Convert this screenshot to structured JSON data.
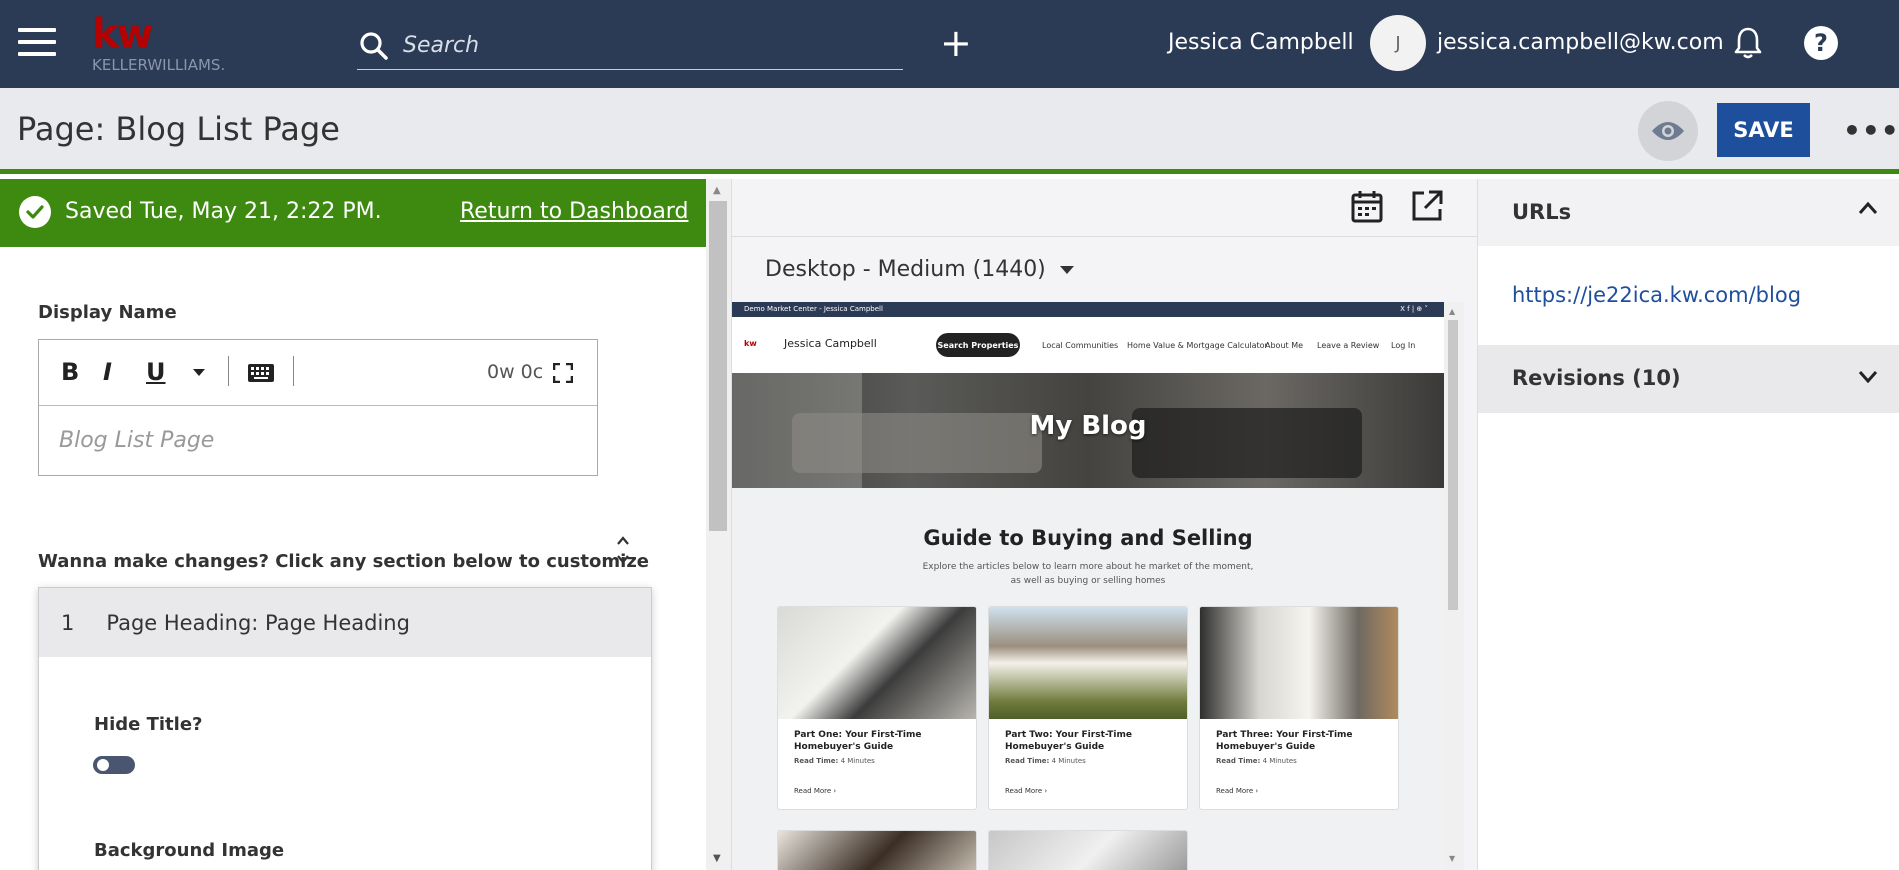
{
  "topbar": {
    "logo_mark": "kw",
    "logo_text": "KELLERWILLIAMS.",
    "search_placeholder": "Search",
    "add_label": "+",
    "user_name": "Jessica Campbell",
    "avatar_initial": "J",
    "user_email": "jessica.campbell@kw.com",
    "help_label": "?",
    "icons": [
      "hamburger-icon",
      "search-icon",
      "plus-icon",
      "bell-icon",
      "help-icon"
    ]
  },
  "pagebar": {
    "title": "Page: Blog List Page",
    "save_label": "SAVE",
    "more_label": "•••"
  },
  "left": {
    "saved_text": "Saved Tue, May 21, 2:22 PM.",
    "return_link": "Return to Dashboard",
    "display_name_label": "Display Name",
    "editor": {
      "bold": "B",
      "italic": "I",
      "underline": "U",
      "counter": "0w 0c",
      "placeholder": "Blog List Page"
    },
    "customize_label": "Wanna make changes? Click any section below to customize",
    "section": {
      "number": "1",
      "name": "Page Heading: Page Heading",
      "hide_title_label": "Hide Title?",
      "hide_title_on": false,
      "background_label": "Background Image"
    }
  },
  "middle": {
    "viewport": "Desktop - Medium (1440)",
    "preview": {
      "strip_left": "Demo Market Center - Jessica Campbell",
      "strip_right": "X  f  |  ⊕ ˅",
      "site_logo": "kw",
      "site_name": "Jessica Campbell",
      "search_button": "Search Properties",
      "nav_links": [
        "Local Communities",
        "Home Value & Mortgage Calculator",
        "About Me",
        "Leave a Review",
        "Log In"
      ],
      "hero_title": "My Blog",
      "guide_title": "Guide to Buying and Selling",
      "guide_desc": "Explore the articles below to learn more about he market of the moment, as well as buying or selling homes",
      "cards": [
        {
          "title": "Part One: Your First-Time Homebuyer's Guide",
          "read_time_label": "Read Time:",
          "read_time": "4 Minutes",
          "read_more": "Read More  ›"
        },
        {
          "title": "Part Two: Your First-Time Homebuyer's Guide",
          "read_time_label": "Read Time:",
          "read_time": "4 Minutes",
          "read_more": "Read More  ›"
        },
        {
          "title": "Part Three: Your First-Time Homebuyer's Guide",
          "read_time_label": "Read Time:",
          "read_time": "4 Minutes",
          "read_more": "Read More  ›"
        }
      ]
    }
  },
  "right": {
    "urls_label": "URLs",
    "url": "https://je22ica.kw.com/blog",
    "revisions_label": "Revisions (10)"
  },
  "colors": {
    "nav_bg": "#2b3a55",
    "saved_green": "#3e8a11",
    "save_blue": "#1e4f9c",
    "brand_red": "#b40101"
  }
}
